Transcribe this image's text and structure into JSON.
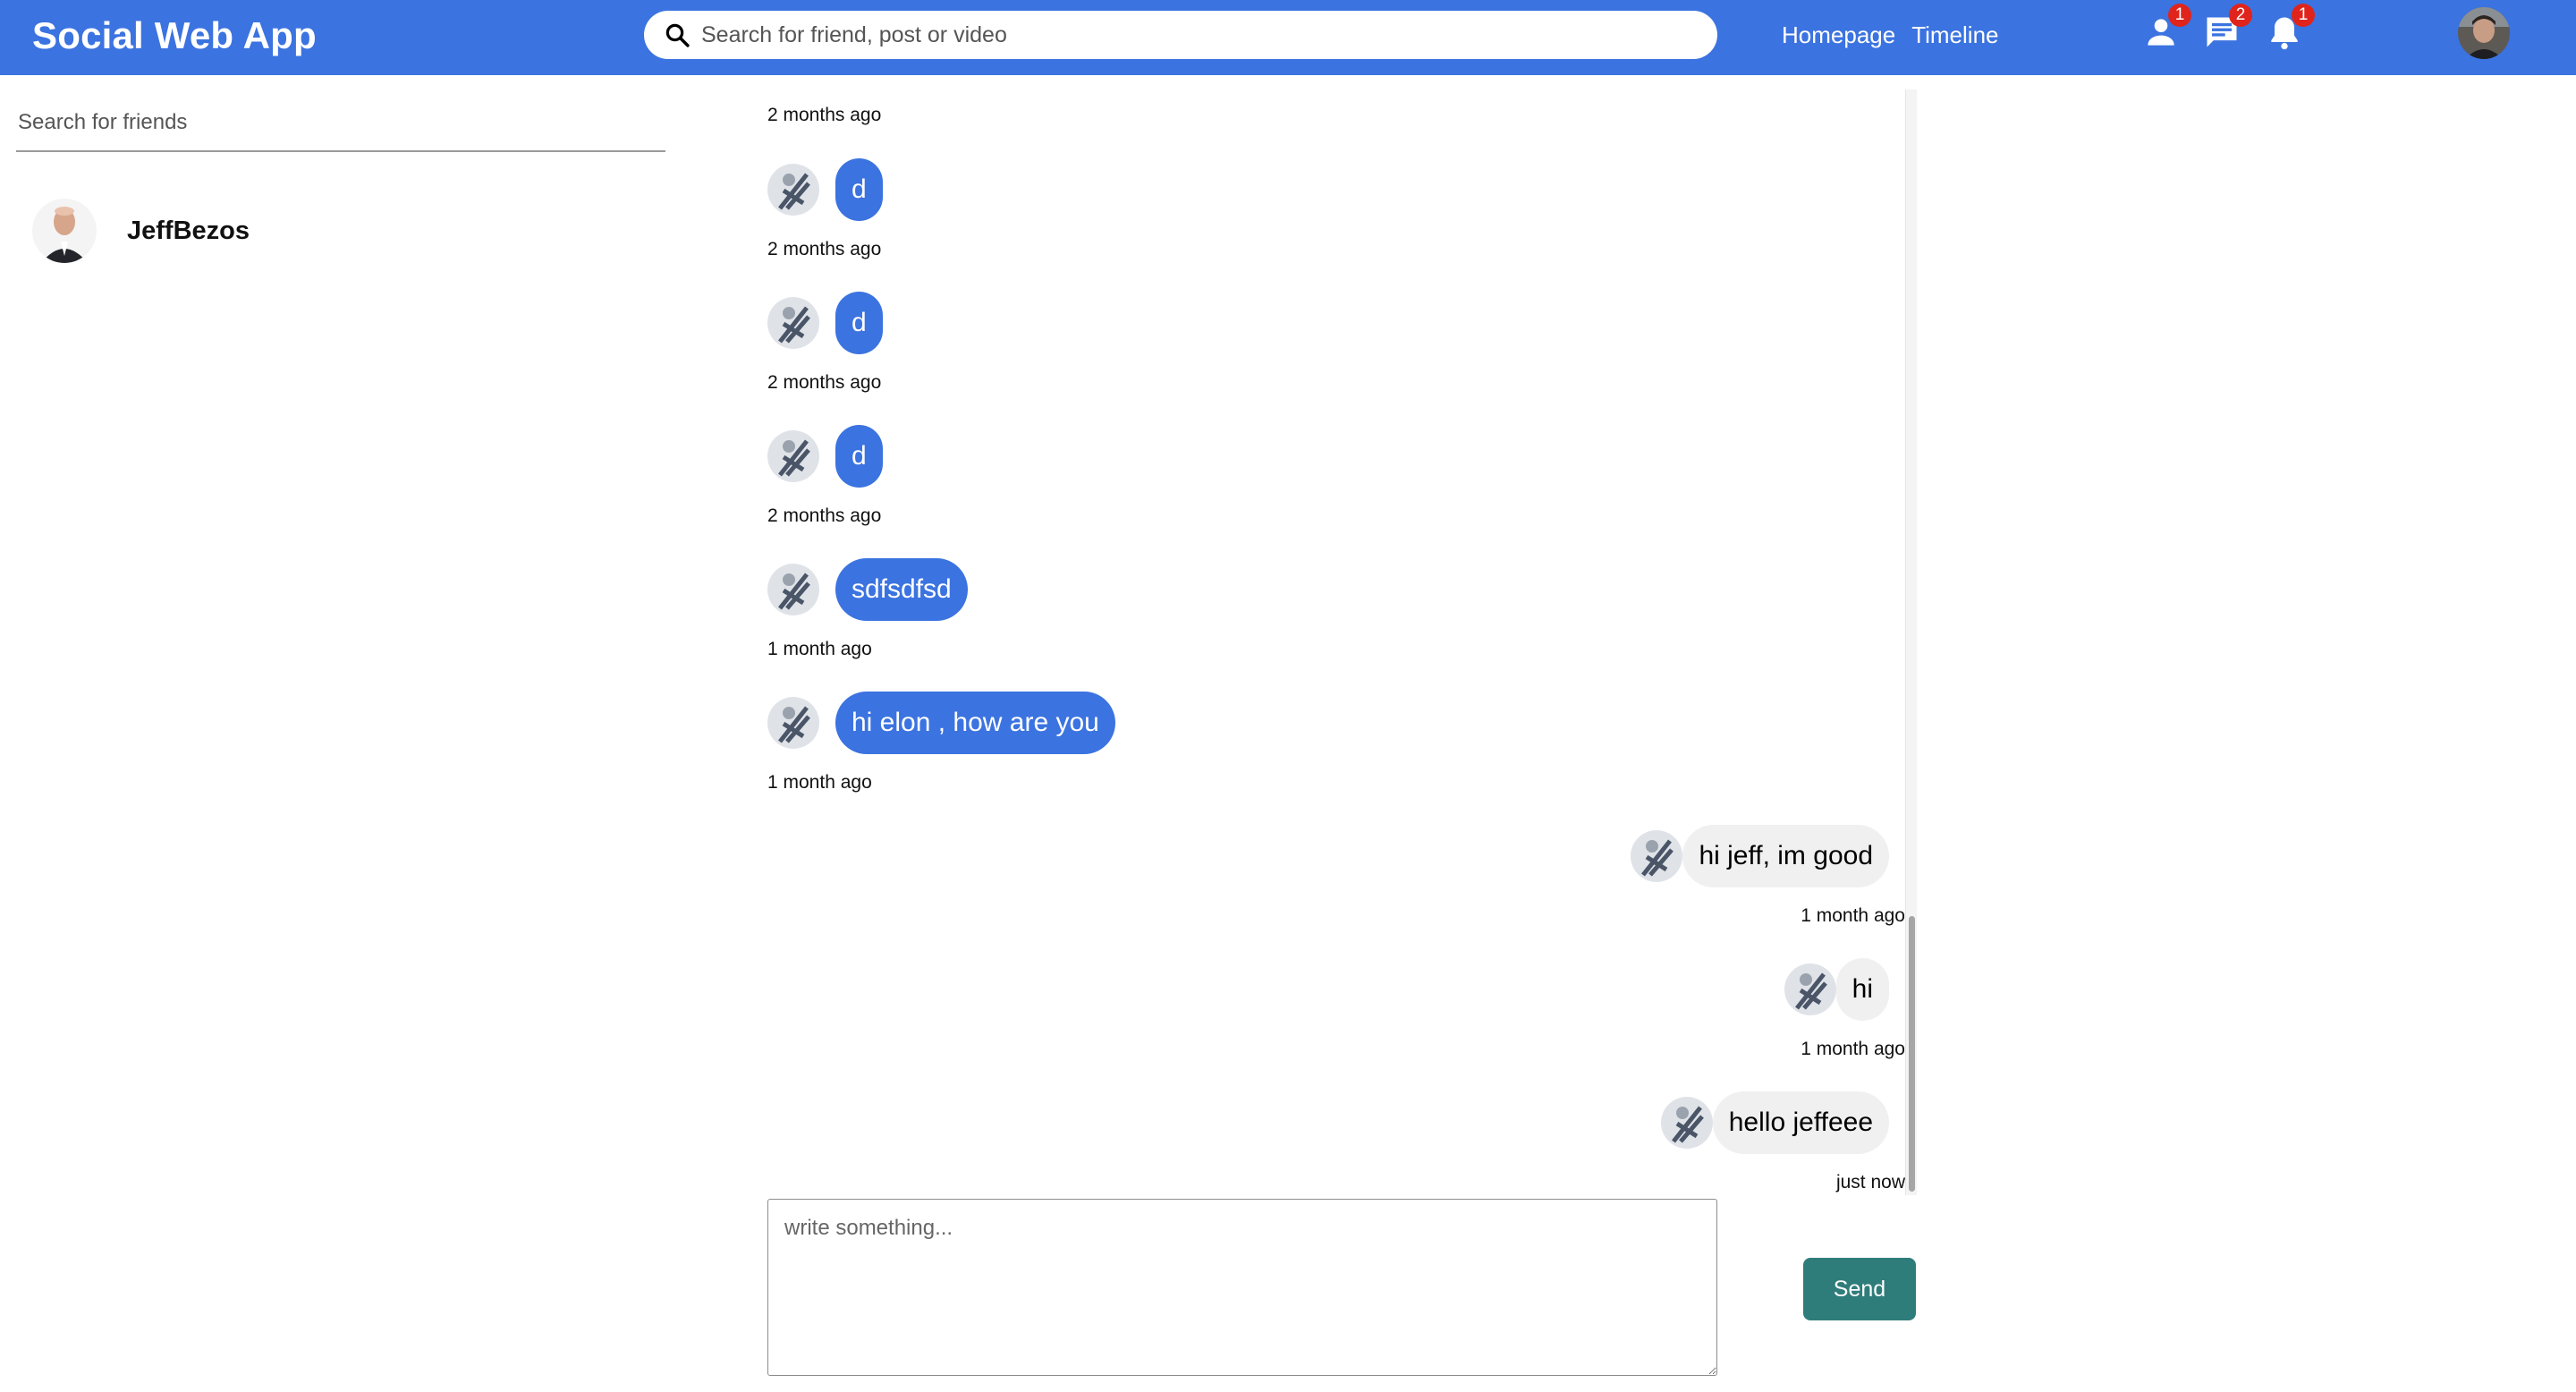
{
  "header": {
    "logo": "Social Web App",
    "search_placeholder": "Search for friend, post or video",
    "nav": [
      "Homepage",
      "Timeline"
    ],
    "icons": [
      {
        "name": "person-icon",
        "badge": "1"
      },
      {
        "name": "chat-icon",
        "badge": "2"
      },
      {
        "name": "notifications-icon",
        "badge": "1"
      }
    ],
    "accent_color": "#3b73e0",
    "badge_color": "#e0241b"
  },
  "sidebar": {
    "search_placeholder": "Search for friends",
    "friends": [
      {
        "name": "JeffBezos"
      }
    ]
  },
  "chat": {
    "messages": [
      {
        "timestamp": "2 months ago"
      },
      {
        "text": "d",
        "own": false,
        "timestamp": "2 months ago"
      },
      {
        "text": "d",
        "own": false,
        "timestamp": "2 months ago"
      },
      {
        "text": "d",
        "own": false,
        "timestamp": "2 months ago"
      },
      {
        "text": "sdfsdfsd",
        "own": false,
        "timestamp": "1 month ago"
      },
      {
        "text": "hi elon , how are you",
        "own": false,
        "timestamp": "1 month ago"
      },
      {
        "text": "hi jeff, im good",
        "own": true,
        "timestamp": "1 month ago"
      },
      {
        "text": "hi",
        "own": true,
        "timestamp": "1 month ago"
      },
      {
        "text": "hello jeffeee",
        "own": true,
        "timestamp": "just now"
      }
    ],
    "sent_bubble_color": "#3b73e0",
    "received_bubble_color": "#f1f0f0"
  },
  "composer": {
    "placeholder": "write something...",
    "send_label": "Send",
    "send_color": "#2f7d7b"
  }
}
